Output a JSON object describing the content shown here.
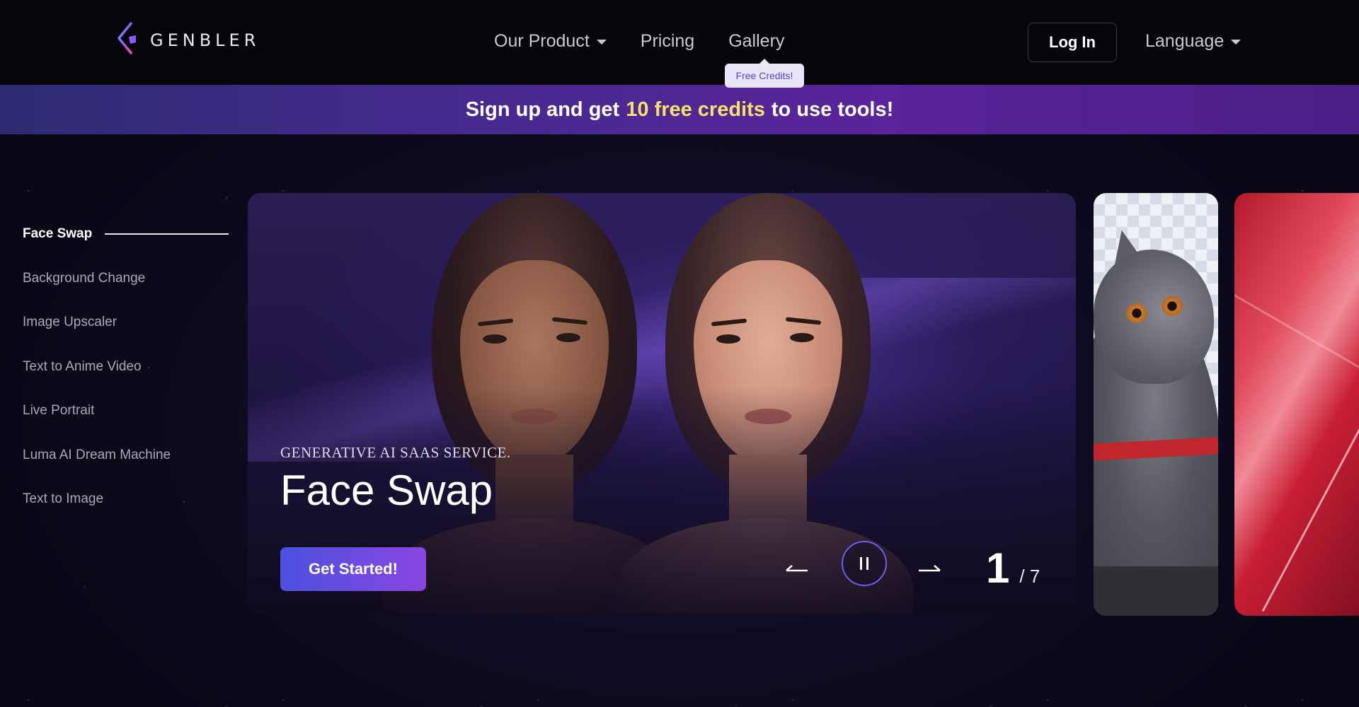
{
  "brand": {
    "name": "GENBLER"
  },
  "nav": {
    "items": [
      {
        "label": "Our Product",
        "has_dropdown": true
      },
      {
        "label": "Pricing",
        "has_dropdown": false
      },
      {
        "label": "Gallery",
        "has_dropdown": false
      }
    ],
    "gallery_tooltip": "Free Credits!",
    "login_label": "Log In",
    "language_label": "Language"
  },
  "banner": {
    "prefix": "Sign up and get",
    "highlight": "10 free credits",
    "suffix": "to use tools!"
  },
  "sidebar": {
    "items": [
      {
        "label": "Face Swap",
        "active": true
      },
      {
        "label": "Background Change",
        "active": false
      },
      {
        "label": "Image Upscaler",
        "active": false
      },
      {
        "label": "Text to Anime Video",
        "active": false
      },
      {
        "label": "Live Portrait",
        "active": false
      },
      {
        "label": "Luma AI Dream Machine",
        "active": false
      },
      {
        "label": "Text to Image",
        "active": false
      }
    ]
  },
  "slide": {
    "eyebrow": "GENERATIVE AI SAAS SERVICE.",
    "title": "Face Swap",
    "cta_label": "Get Started!",
    "current": "1",
    "total": "/ 7"
  },
  "icons": {
    "prev": "arrow-left-icon",
    "next": "arrow-right-icon",
    "pause": "pause-icon",
    "logo": "genbler-logo-icon"
  },
  "colors": {
    "accent": "#6f5cf0",
    "banner_highlight": "#f5e26a",
    "cta_start": "#4b52df",
    "cta_end": "#8a45e0"
  }
}
